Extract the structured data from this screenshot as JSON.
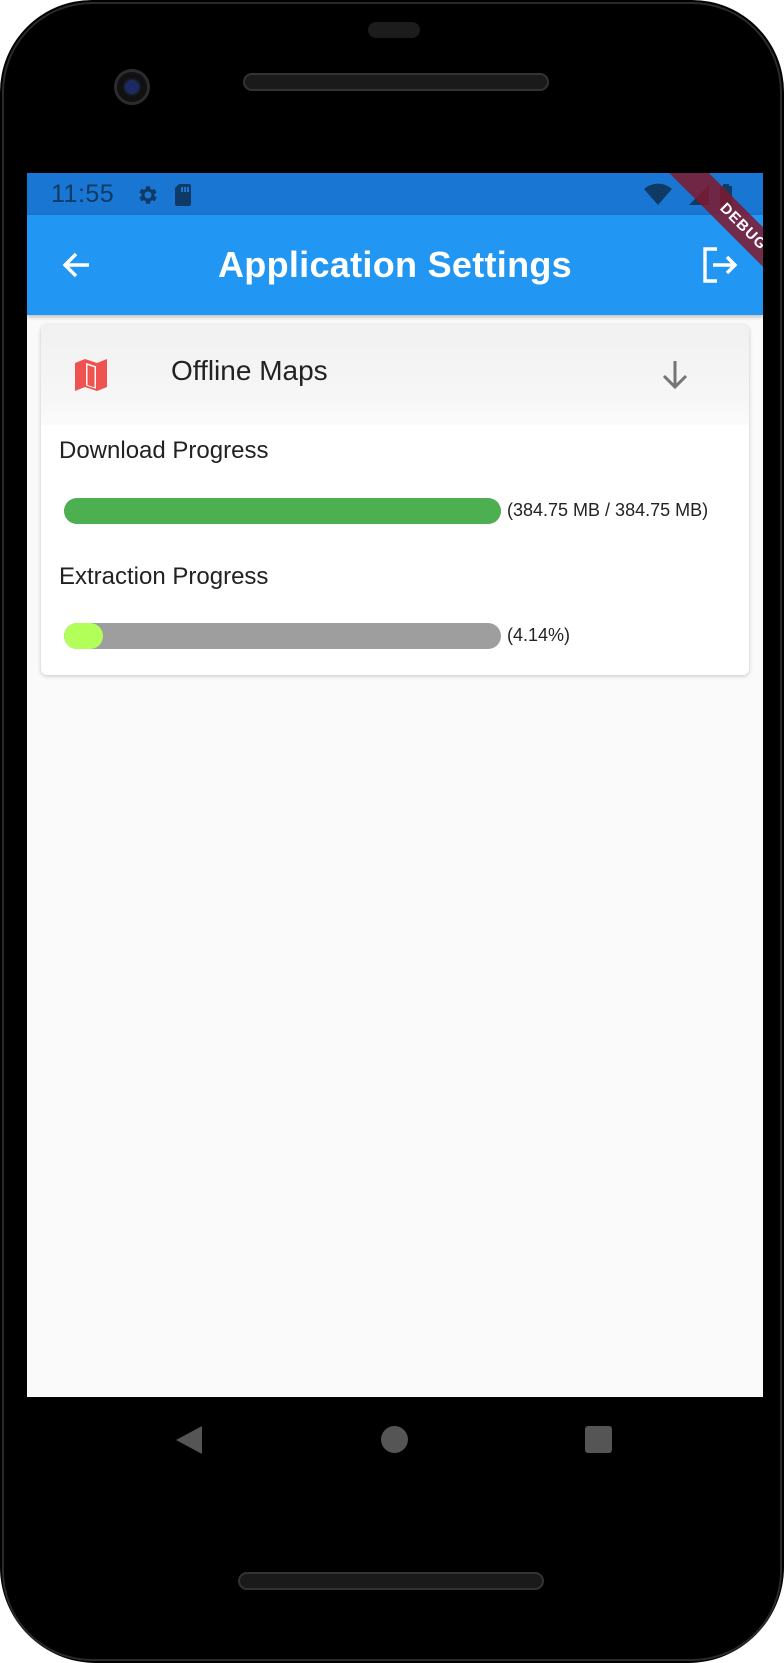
{
  "status_bar": {
    "time": "11:55",
    "icons": [
      "settings-icon",
      "sd-card-icon",
      "wifi-icon",
      "signal-icon",
      "battery-icon"
    ]
  },
  "app_bar": {
    "title": "Application Settings",
    "back_icon": "arrow-back-icon",
    "logout_icon": "logout-icon",
    "color": "#2196f3"
  },
  "debug_banner": {
    "label": "DEBUG"
  },
  "offline_maps": {
    "title": "Offline Maps",
    "icon": "map-icon",
    "icon_color": "#ef5350",
    "expand_icon": "arrow-down-icon",
    "download": {
      "label": "Download Progress",
      "value_text": "(384.75 MB / 384.75 MB)",
      "progress": 1.0,
      "color": "#4caf50"
    },
    "extraction": {
      "label": "Extraction Progress",
      "value_text": "(4.14%)",
      "progress": 0.0414,
      "color": "#b2ff59"
    }
  },
  "nav_bar": {
    "back": "triangle-back-icon",
    "home": "circle-home-icon",
    "recents": "square-recents-icon"
  }
}
